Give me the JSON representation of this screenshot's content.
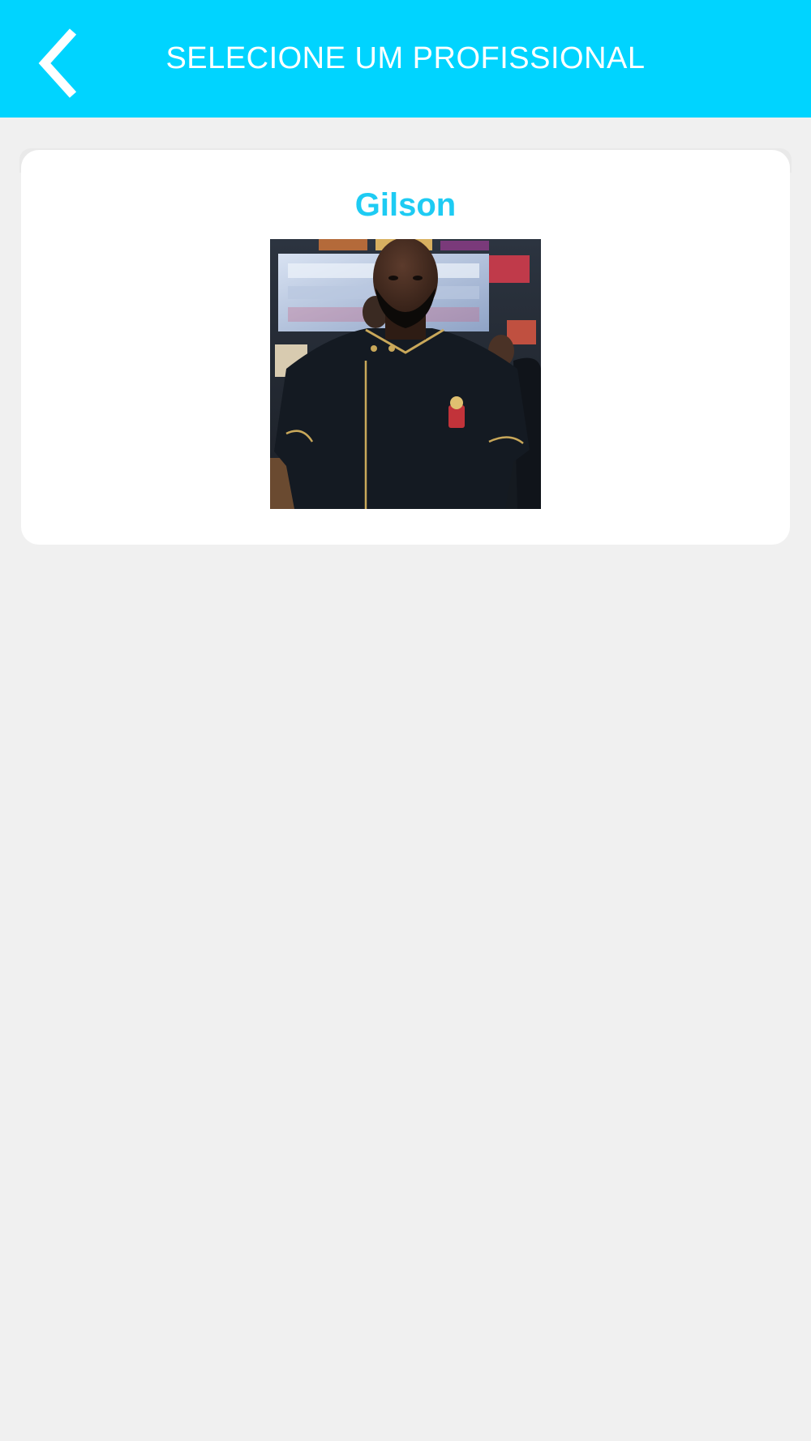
{
  "header": {
    "title": "SELECIONE UM PROFISSIONAL",
    "back_icon": "chevron-left-icon",
    "background_color": "#00d4ff"
  },
  "professionals": [
    {
      "name": "Gilson",
      "photo_alt": "Gilson",
      "name_color": "#1ecbf3"
    }
  ]
}
